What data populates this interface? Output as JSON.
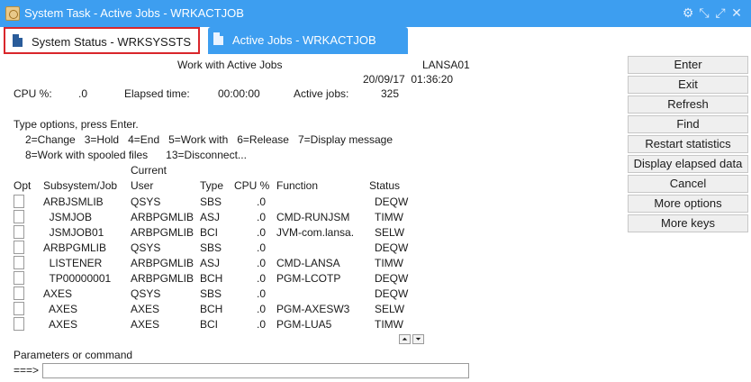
{
  "window": {
    "title": "System Task - Active Jobs - WRKACTJOB",
    "controls": [
      "settings-icon",
      "shrink-icon",
      "expand-icon",
      "close-icon"
    ]
  },
  "tabs": [
    {
      "label": "System Status - WRKSYSSTS",
      "active": true
    },
    {
      "label": "Active Jobs - WRKACTJOB",
      "active": false
    }
  ],
  "screen": {
    "heading": "Work with Active Jobs",
    "system": "LANSA01",
    "datetime": "20/09/17  01:36:20",
    "cpu_label": "CPU %:",
    "cpu_value": ".0",
    "elapsed_label": "Elapsed time:",
    "elapsed_value": "00:00:00",
    "active_jobs_label": "Active jobs:",
    "active_jobs_value": "325",
    "instructions": "Type options, press Enter.",
    "options_line1": "2=Change   3=Hold   4=End   5=Work with   6=Release   7=Display message",
    "options_line2": "8=Work with spooled files      13=Disconnect...",
    "col_current": "Current",
    "columns": {
      "opt": "Opt",
      "subsystem": "Subsystem/Job",
      "user": "User",
      "type": "Type",
      "cpu": "CPU %",
      "function": "Function",
      "status": "Status"
    },
    "rows": [
      {
        "job": "ARBJSMLIB",
        "user": "QSYS",
        "type": "SBS",
        "cpu": ".0",
        "function": "",
        "status": "DEQW"
      },
      {
        "job": "  JSMJOB",
        "user": "ARBPGMLIB",
        "type": "ASJ",
        "cpu": ".0",
        "function": "CMD-RUNJSM",
        "status": "TIMW"
      },
      {
        "job": "  JSMJOB01",
        "user": "ARBPGMLIB",
        "type": "BCI",
        "cpu": ".0",
        "function": "JVM-com.lansa.",
        "status": "SELW"
      },
      {
        "job": "ARBPGMLIB",
        "user": "QSYS",
        "type": "SBS",
        "cpu": ".0",
        "function": "",
        "status": "DEQW"
      },
      {
        "job": "  LISTENER",
        "user": "ARBPGMLIB",
        "type": "ASJ",
        "cpu": ".0",
        "function": "CMD-LANSA",
        "status": "TIMW"
      },
      {
        "job": "  TP00000001",
        "user": "ARBPGMLIB",
        "type": "BCH",
        "cpu": ".0",
        "function": "PGM-LCOTP",
        "status": "DEQW"
      },
      {
        "job": "AXES",
        "user": "QSYS",
        "type": "SBS",
        "cpu": ".0",
        "function": "",
        "status": "DEQW"
      },
      {
        "job": "  AXES",
        "user": "AXES",
        "type": "BCH",
        "cpu": ".0",
        "function": "PGM-AXESW3",
        "status": "SELW"
      },
      {
        "job": "  AXES",
        "user": "AXES",
        "type": "BCI",
        "cpu": ".0",
        "function": "PGM-LUA5",
        "status": "TIMW"
      }
    ],
    "scroll_up_glyph": "⏶",
    "scroll_down_glyph": "⏷",
    "params_label": "Parameters or command",
    "prompt": "===>",
    "command_value": ""
  },
  "side_buttons": [
    "Enter",
    "Exit",
    "Refresh",
    "Find",
    "Restart statistics",
    "Display elapsed data",
    "Cancel",
    "More options",
    "More keys"
  ],
  "colors": {
    "titlebar": "#3d9ef0",
    "active_tab_border": "#d9262b"
  }
}
